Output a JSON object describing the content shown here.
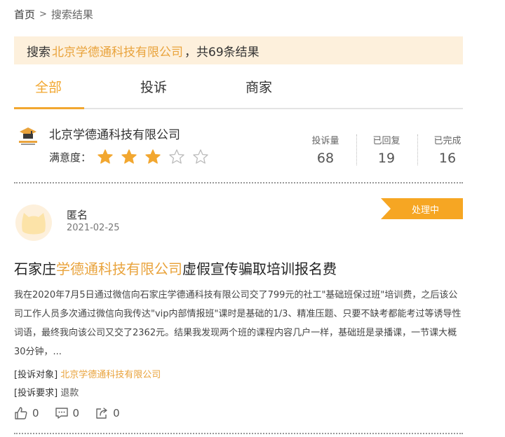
{
  "breadcrumb": {
    "home": "首页",
    "separator": ">",
    "current": "搜索结果"
  },
  "search": {
    "prefix": "搜索",
    "keyword": "北京学德通科技有限公司",
    "suffix": "，共69条结果"
  },
  "tabs": [
    {
      "label": "全部",
      "active": true
    },
    {
      "label": "投诉",
      "active": false
    },
    {
      "label": "商家",
      "active": false
    }
  ],
  "company": {
    "name": "北京学德通科技有限公司",
    "satisfaction_label": "满意度：",
    "rating": 3,
    "rating_max": 5,
    "stats": [
      {
        "label": "投诉量",
        "value": "68"
      },
      {
        "label": "已回复",
        "value": "19"
      },
      {
        "label": "已完成",
        "value": "16"
      }
    ]
  },
  "post": {
    "author": "匿名",
    "date": "2021-02-25",
    "status": "处理中",
    "title_prefix": "石家庄",
    "title_highlight": "学德通科技有限公司",
    "title_suffix": "虚假宣传骗取培训报名费",
    "body": "我在2020年7月5日通过微信向石家庄学德通科技有限公司交了799元的社工\"基础班保过班\"培训费，之后该公司工作人员多次通过微信向我传达\"vip内部情报班\"课时是基础的1/3、精准压题、只要不缺考都能考过等诱导性词语，最终我向该公司又交了2362元。结果我发现两个班的课程内容几户一样，基础班是录播课，一节课大概30分钟，...",
    "target_label": "[投诉对象]",
    "target_value": "北京学德通科技有限公司",
    "request_label": "[投诉要求]",
    "request_value": "退款",
    "likes": "0",
    "comments": "0",
    "shares": "0"
  },
  "colors": {
    "accent": "#f2a730",
    "banner_bg": "#fdf0dc",
    "badge": "#f6a623"
  }
}
